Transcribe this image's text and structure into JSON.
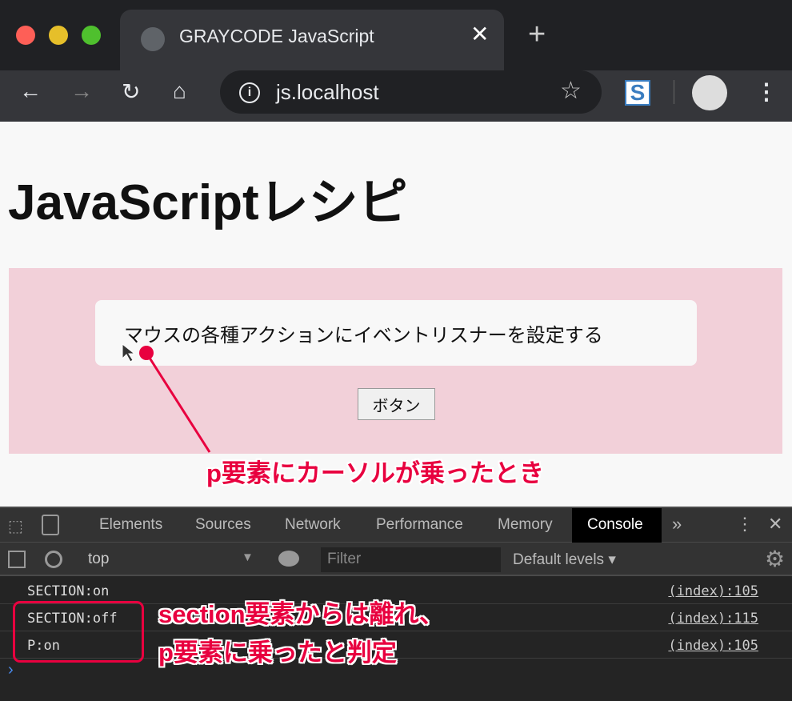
{
  "browser": {
    "tab_title": "GRAYCODE JavaScript",
    "url": "js.localhost",
    "new_tab": "+",
    "close": "✕"
  },
  "page": {
    "heading": "JavaScriptレシピ",
    "paragraph": "マウスの各種アクションにイベントリスナーを設定する",
    "button_label": "ボタン"
  },
  "annotations": {
    "cursor_note": "p要素にカーソルが乗ったとき",
    "console_note_line1": "section要素からは離れ、",
    "console_note_line2": "p要素に乗ったと判定",
    "color": "#e8003f"
  },
  "devtools": {
    "tabs": [
      "Elements",
      "Sources",
      "Network",
      "Performance",
      "Memory",
      "Console"
    ],
    "active_tab": "Console",
    "more": "»",
    "context": "top",
    "filter_placeholder": "Filter",
    "levels": "Default levels ▾",
    "logs": [
      {
        "message": "SECTION:on",
        "source": "(index):105"
      },
      {
        "message": "SECTION:off",
        "source": "(index):115"
      },
      {
        "message": "P:on",
        "source": "(index):105"
      }
    ],
    "prompt": "›"
  }
}
